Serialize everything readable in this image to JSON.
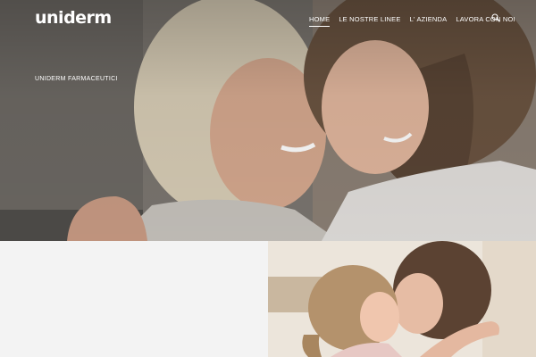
{
  "brand": {
    "logo_text": "uniderm"
  },
  "nav": {
    "items": [
      {
        "label": "HOME",
        "active": true
      },
      {
        "label": "LE NOSTRE LINEE",
        "active": false
      },
      {
        "label": "L' AZIENDA",
        "active": false
      },
      {
        "label": "LAVORA CON NOI",
        "active": false
      }
    ],
    "search_icon": "search-icon"
  },
  "hero": {
    "subtitle": "UNIDERM FARMACEUTICI",
    "image": "hero-photo-mother-and-daughter"
  },
  "feature": {
    "image": "feature-photo-mother-and-child"
  },
  "colors": {
    "text_on_hero": "#ffffff",
    "lower_panel_bg": "#f3f3f3"
  }
}
